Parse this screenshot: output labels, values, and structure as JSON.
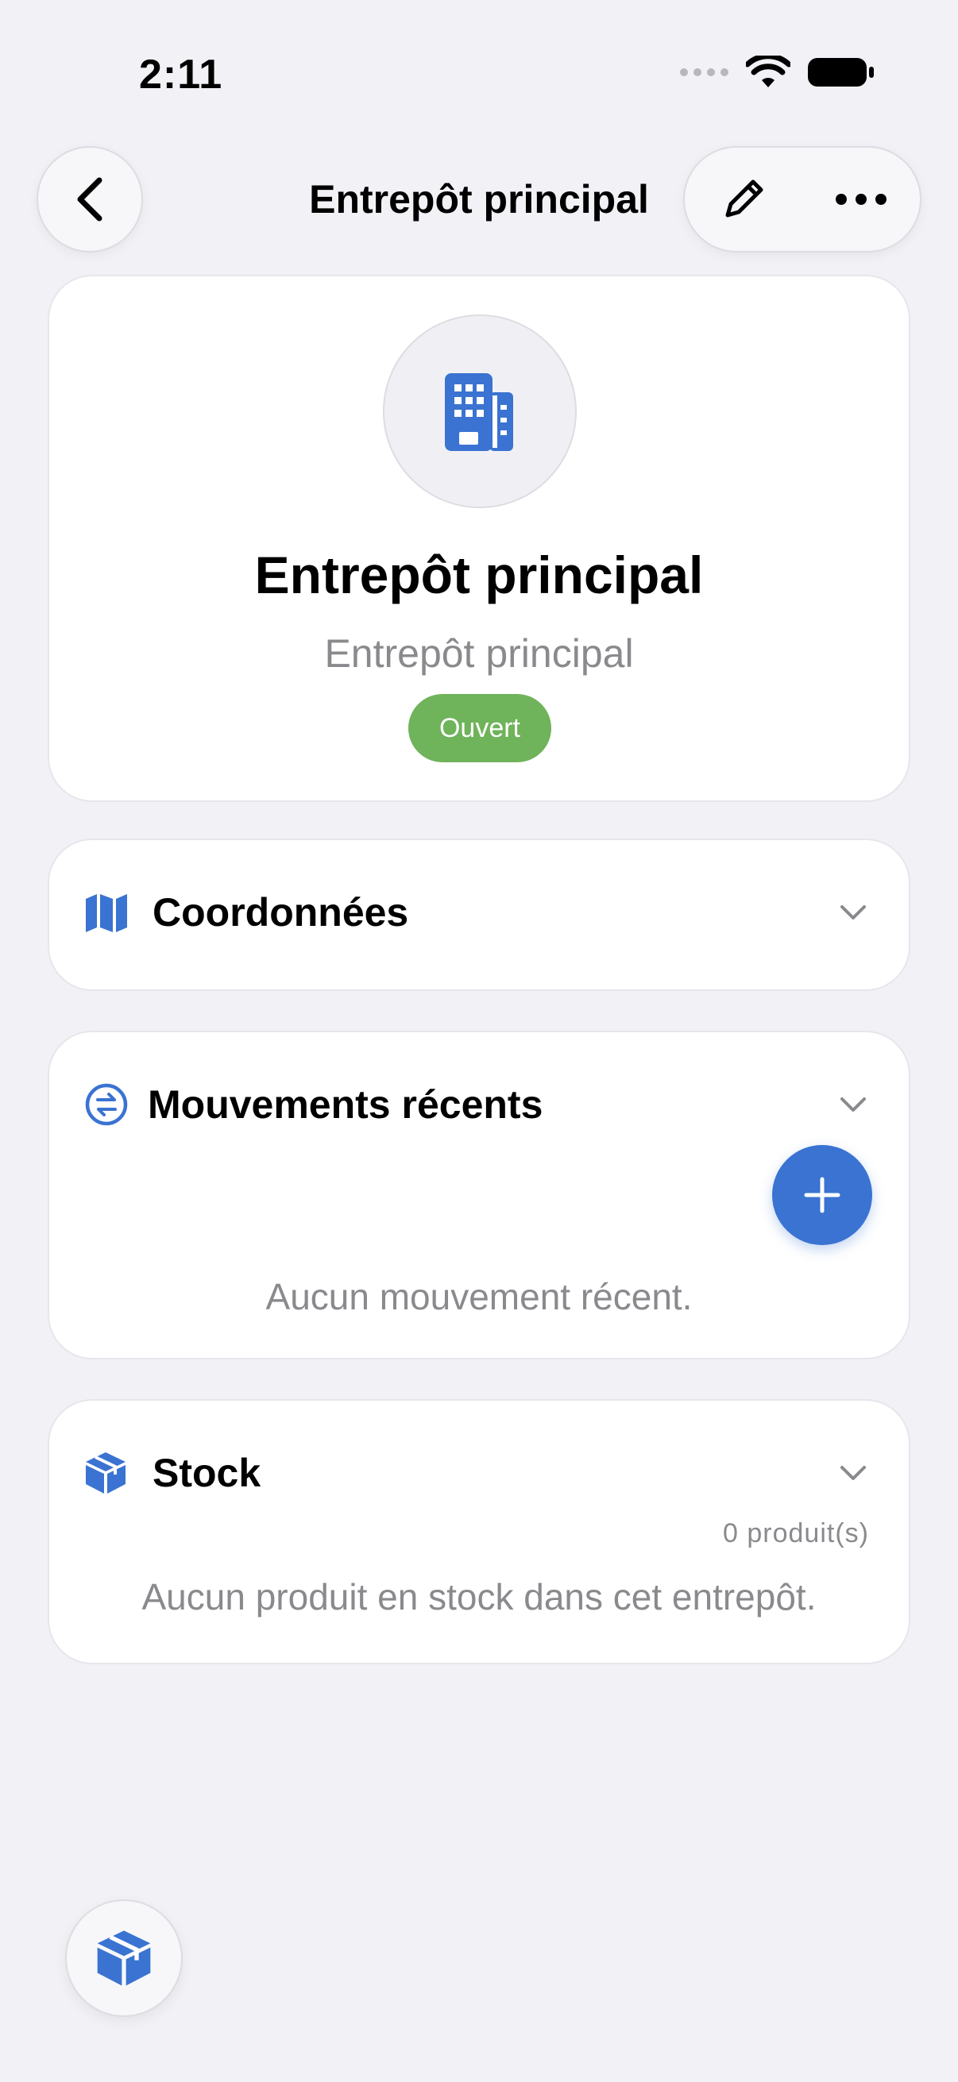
{
  "status_bar": {
    "time": "2:11"
  },
  "nav": {
    "title": "Entrepôt principal"
  },
  "hero": {
    "title": "Entrepôt principal",
    "subtitle": "Entrepôt principal",
    "status_badge": "Ouvert"
  },
  "sections": {
    "coordinates": {
      "label": "Coordonnées",
      "icon": "map-icon"
    },
    "movements": {
      "label": "Mouvements récents",
      "icon": "arrows-exchange-icon",
      "empty": "Aucun mouvement récent."
    },
    "stock": {
      "label": "Stock",
      "icon": "cube-icon",
      "count": "0 produit(s)",
      "empty": "Aucun produit en stock dans cet entrepôt."
    }
  },
  "colors": {
    "accent": "#3a73d1",
    "badge_green": "#6fb35a",
    "background": "#f1f1f6"
  }
}
